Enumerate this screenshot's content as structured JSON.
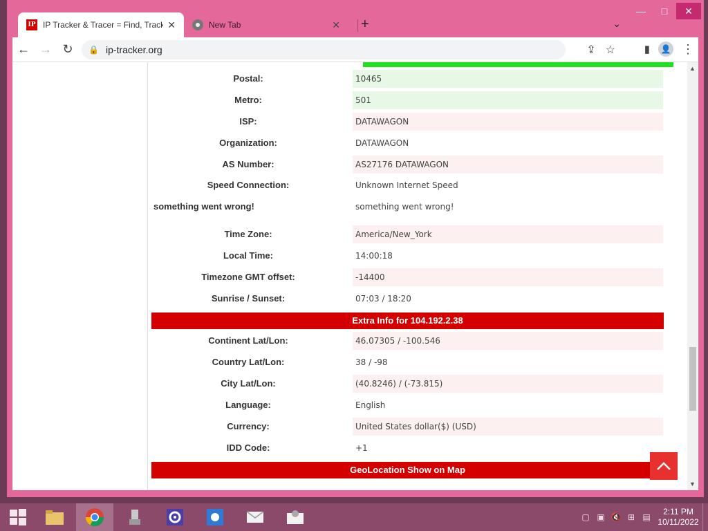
{
  "browser": {
    "tabs": [
      {
        "title": "IP Tracker & Tracer = Find, Track",
        "favicon": "IP",
        "active": true
      },
      {
        "title": "New Tab",
        "active": false
      }
    ],
    "url": "ip-tracker.org",
    "window_controls": {
      "minimize": "—",
      "maximize": "□",
      "close": "✕"
    }
  },
  "rows_top": [
    {
      "label": "Postal:",
      "value": "10465",
      "style": "green"
    },
    {
      "label": "Metro:",
      "value": "501",
      "style": "green"
    },
    {
      "label": "ISP:",
      "value": "DATAWAGON",
      "style": "pink"
    },
    {
      "label": "Organization:",
      "value": "DATAWAGON",
      "style": "white"
    },
    {
      "label": "AS Number:",
      "value": "AS27176 DATAWAGON",
      "style": "pink"
    },
    {
      "label": "Speed Connection:",
      "value": "Unknown Internet Speed",
      "style": "white"
    },
    {
      "label": "something went wrong!",
      "value": "something went wrong!",
      "style": "white"
    }
  ],
  "rows_time": [
    {
      "label": "Time Zone:",
      "value": "America/New_York",
      "style": "pink"
    },
    {
      "label": "Local Time:",
      "value": "14:00:18",
      "style": "white"
    },
    {
      "label": "Timezone GMT offset:",
      "value": "-14400",
      "style": "pink"
    },
    {
      "label": "Sunrise / Sunset:",
      "value": "07:03 / 18:20",
      "style": "white"
    }
  ],
  "extra_header": "Extra Info for 104.192.2.38",
  "rows_extra": [
    {
      "label": "Continent Lat/Lon:",
      "value": "46.07305 / -100.546",
      "style": "pink"
    },
    {
      "label": "Country Lat/Lon:",
      "value": "38 / -98",
      "style": "white"
    },
    {
      "label": "City Lat/Lon:",
      "value": "(40.8246) / (-73.815)",
      "style": "pink"
    },
    {
      "label": "Language:",
      "value": "English",
      "style": "white"
    },
    {
      "label": "Currency:",
      "value": "United States dollar($) (USD)",
      "style": "pink"
    },
    {
      "label": "IDD Code:",
      "value": "+1",
      "style": "white"
    }
  ],
  "geo_header": "GeoLocation Show on Map",
  "taskbar": {
    "time": "2:11 PM",
    "date": "10/11/2022"
  }
}
